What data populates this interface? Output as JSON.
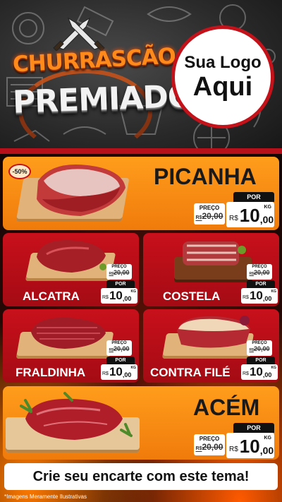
{
  "brand": {
    "line1": "CHURRASCÃO",
    "line2": "PREMIADO"
  },
  "logo": {
    "line1": "Sua Logo",
    "line2": "Aqui"
  },
  "products": [
    {
      "name": "PICANHA",
      "discount": "-50%",
      "price_label": "PREÇO",
      "old_price": "20,00",
      "old_currency": "R$",
      "por_label": "POR",
      "currency": "R$",
      "price_int": "10",
      "price_dec": ",00",
      "unit": "KG"
    },
    {
      "name": "ALCATRA",
      "price_label": "PREÇO",
      "old_price": "20,00",
      "old_currency": "R$",
      "por_label": "POR",
      "currency": "R$",
      "price_int": "10",
      "price_dec": ",00",
      "unit": "KG"
    },
    {
      "name": "COSTELA",
      "price_label": "PREÇO",
      "old_price": "20,00",
      "old_currency": "R$",
      "por_label": "POR",
      "currency": "R$",
      "price_int": "10",
      "price_dec": ",00",
      "unit": "KG"
    },
    {
      "name": "FRALDINHA",
      "price_label": "PREÇO",
      "old_price": "20,00",
      "old_currency": "R$",
      "por_label": "POR",
      "currency": "R$",
      "price_int": "10",
      "price_dec": ",00",
      "unit": "KG"
    },
    {
      "name": "CONTRA FILÉ",
      "price_label": "PREÇO",
      "old_price": "20,00",
      "old_currency": "R$",
      "por_label": "POR",
      "currency": "R$",
      "price_int": "10",
      "price_dec": ",00",
      "unit": "KG"
    },
    {
      "name": "ACÉM",
      "price_label": "PREÇO",
      "old_price": "20,00",
      "old_currency": "R$",
      "por_label": "POR",
      "currency": "R$",
      "price_int": "10",
      "price_dec": ",00",
      "unit": "KG"
    }
  ],
  "footer": {
    "cta": "Crie seu encarte com este tema!",
    "disclaimer": "*Imagens Meramente Ilustrativas"
  },
  "colors": {
    "orange_card": "#f58a12",
    "red_card": "#b80e18",
    "brand_orange": "#ff8a1c",
    "logo_ring": "#c4121a"
  },
  "icons": [
    "crossed-knives-icon",
    "grill-doodles-background",
    "meat-product-image"
  ]
}
